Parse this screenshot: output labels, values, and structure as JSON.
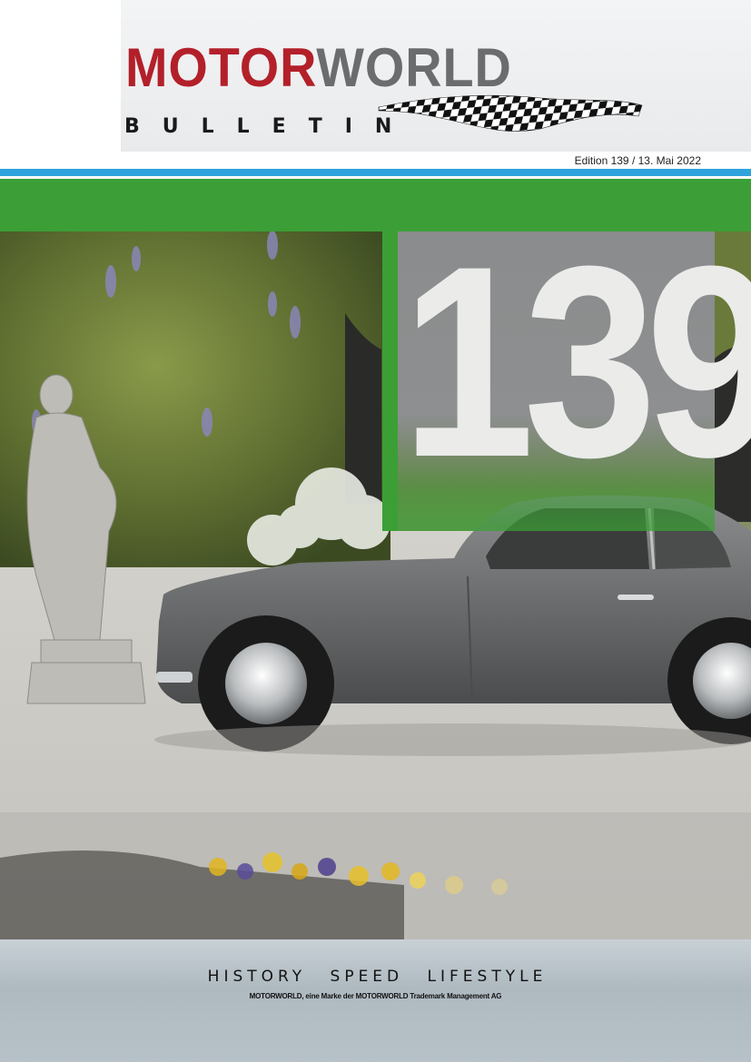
{
  "header": {
    "logo_motor": "MOTOR",
    "logo_world": "WORLD",
    "bulletin": "BULLETIN",
    "edition": "Edition 139 / 13. Mai 2022"
  },
  "cover": {
    "issue_number": "139"
  },
  "footer": {
    "tagline": "HISTORY SPEED LIFESTYLE",
    "trademark": "MOTORWORLD, eine Marke der MOTORWORLD Trademark Management AG"
  },
  "colors": {
    "brand_red": "#b3202a",
    "brand_grey": "#6b6c6e",
    "stripe_blue": "#2fa3dd",
    "stripe_green": "#3c9e36",
    "panel_grey": "#8a8c8d"
  },
  "icons": {
    "logo_flag": "checkered-flag-icon"
  }
}
